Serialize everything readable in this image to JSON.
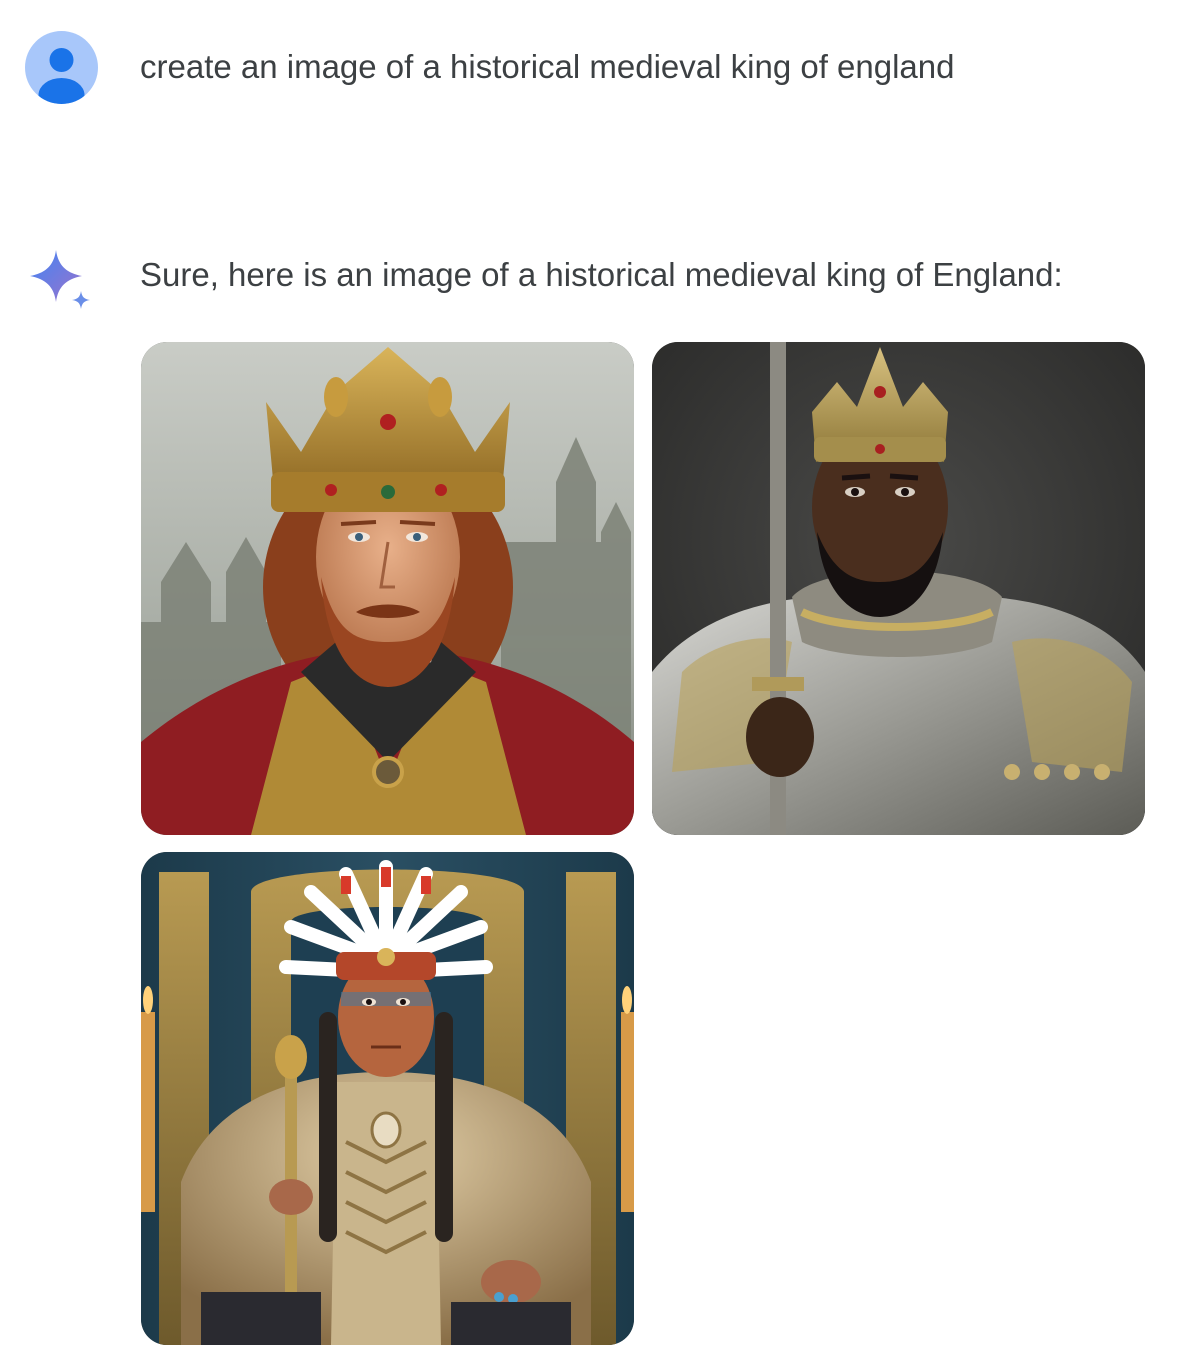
{
  "conversation": {
    "user_prompt": {
      "avatar_icon": "user-avatar-icon",
      "text": "create an image of a historical medieval king of england"
    },
    "model_response": {
      "icon": "sparkle-icon",
      "text": "Sure, here is an image of a historical medieval king of England:",
      "images": [
        {
          "subject": "red-haired king with golden crown and red robe before castle"
        },
        {
          "subject": "king in silver-gold plate armor holding sword"
        },
        {
          "subject": "king in feathered headdress and fur robe on throne holding scepter"
        }
      ]
    }
  },
  "colors": {
    "avatar_bg": "#a8c7fa",
    "avatar_fg": "#1a73e8",
    "sparkle_start": "#4285f4",
    "sparkle_end": "#9b72cb",
    "text": "#3c4043"
  }
}
